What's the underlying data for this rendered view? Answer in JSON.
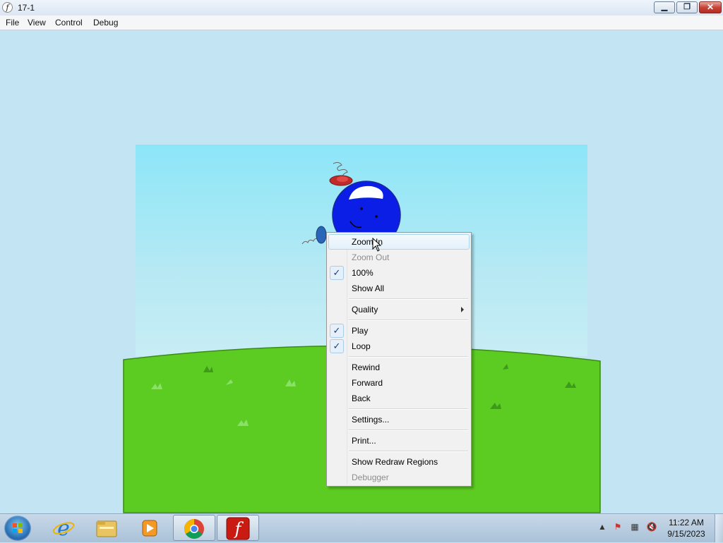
{
  "window": {
    "title": "17-1",
    "app_icon_glyph": "f",
    "buttons": {
      "minimize": "minimize-icon",
      "maximize": "restore-icon",
      "close": "close-icon"
    }
  },
  "menubar": {
    "items": [
      "File",
      "View",
      "Control",
      "Debug"
    ]
  },
  "context_menu": {
    "items": [
      {
        "label": "Zoom In",
        "state": "hover"
      },
      {
        "label": "Zoom Out",
        "state": "disabled"
      },
      {
        "label": "100%",
        "checked": true
      },
      {
        "label": "Show All"
      },
      {
        "label": "Quality",
        "submenu": true
      },
      {
        "label": "Play",
        "checked": true
      },
      {
        "label": "Loop",
        "checked": true
      },
      {
        "label": "Rewind"
      },
      {
        "label": "Forward"
      },
      {
        "label": "Back"
      },
      {
        "label": "Settings..."
      },
      {
        "label": "Print..."
      },
      {
        "label": "Show Redraw Regions"
      },
      {
        "label": "Debugger",
        "state": "disabled"
      }
    ]
  },
  "taskbar": {
    "pinned": [
      "internet-explorer-icon",
      "windows-explorer-icon",
      "media-player-icon",
      "chrome-icon",
      "flash-player-icon"
    ],
    "clock": {
      "time": "11:22 AM",
      "date": "9/15/2023"
    }
  },
  "colors": {
    "sky": "#8ce6f8",
    "grass": "#5ccc22",
    "ball": "#0a1ee6",
    "accent_close": "#c7443a"
  }
}
